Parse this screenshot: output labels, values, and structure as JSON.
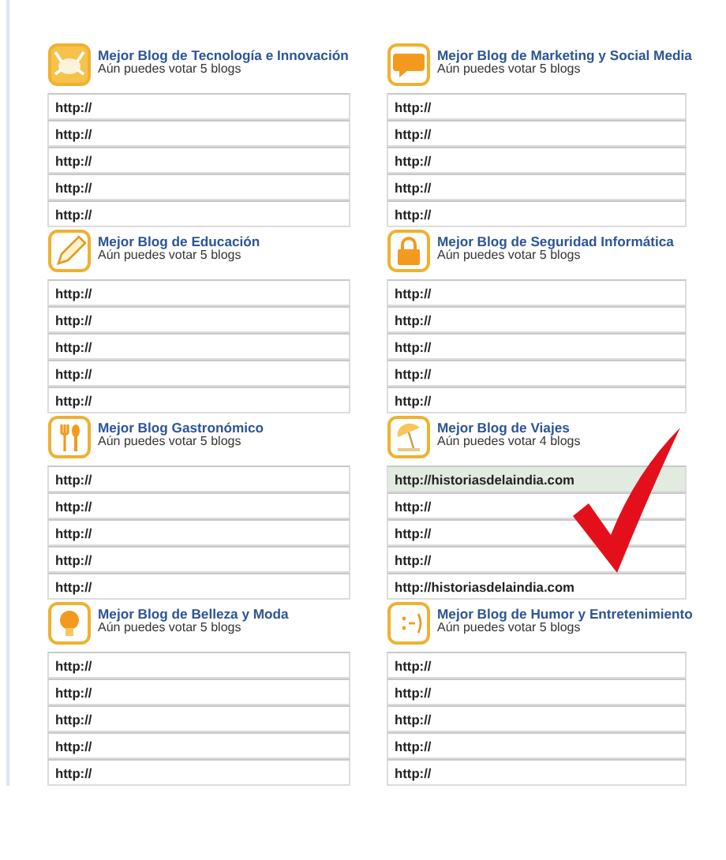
{
  "categories": [
    {
      "title": "Mejor Blog de Tecnología e Innovación",
      "subtitle": "Aún puedes votar 5 blogs",
      "marked": false,
      "fields": [
        {
          "value": "http://",
          "highlighted": false
        },
        {
          "value": "http://",
          "highlighted": false
        },
        {
          "value": "http://",
          "highlighted": false
        },
        {
          "value": "http://",
          "highlighted": false
        },
        {
          "value": "http://",
          "highlighted": false
        }
      ]
    },
    {
      "title": "Mejor Blog de Marketing y Social Media",
      "subtitle": "Aún puedes votar 5 blogs",
      "marked": false,
      "fields": [
        {
          "value": "http://",
          "highlighted": false
        },
        {
          "value": "http://",
          "highlighted": false
        },
        {
          "value": "http://",
          "highlighted": false
        },
        {
          "value": "http://",
          "highlighted": false
        },
        {
          "value": "http://",
          "highlighted": false
        }
      ]
    },
    {
      "title": "Mejor Blog de Educación",
      "subtitle": "Aún puedes votar 5 blogs",
      "marked": false,
      "fields": [
        {
          "value": "http://",
          "highlighted": false
        },
        {
          "value": "http://",
          "highlighted": false
        },
        {
          "value": "http://",
          "highlighted": false
        },
        {
          "value": "http://",
          "highlighted": false
        },
        {
          "value": "http://",
          "highlighted": false
        }
      ]
    },
    {
      "title": "Mejor Blog de Seguridad Informática",
      "subtitle": "Aún puedes votar 5 blogs",
      "marked": false,
      "fields": [
        {
          "value": "http://",
          "highlighted": false
        },
        {
          "value": "http://",
          "highlighted": false
        },
        {
          "value": "http://",
          "highlighted": false
        },
        {
          "value": "http://",
          "highlighted": false
        },
        {
          "value": "http://",
          "highlighted": false
        }
      ]
    },
    {
      "title": "Mejor Blog Gastronómico",
      "subtitle": "Aún puedes votar 5 blogs",
      "marked": false,
      "fields": [
        {
          "value": "http://",
          "highlighted": false
        },
        {
          "value": "http://",
          "highlighted": false
        },
        {
          "value": "http://",
          "highlighted": false
        },
        {
          "value": "http://",
          "highlighted": false
        },
        {
          "value": "http://",
          "highlighted": false
        }
      ]
    },
    {
      "title": "Mejor Blog de Viajes",
      "subtitle": "Aún puedes votar 4 blogs",
      "marked": true,
      "fields": [
        {
          "value": "http://historiasdelaindia.com",
          "highlighted": true
        },
        {
          "value": "http://",
          "highlighted": false
        },
        {
          "value": "http://",
          "highlighted": false
        },
        {
          "value": "http://",
          "highlighted": false
        },
        {
          "value": "http://historiasdelaindia.com",
          "highlighted": false
        }
      ]
    },
    {
      "title": "Mejor Blog de Belleza y Moda",
      "subtitle": "Aún puedes votar 5 blogs",
      "marked": false,
      "fields": [
        {
          "value": "http://",
          "highlighted": false
        },
        {
          "value": "http://",
          "highlighted": false
        },
        {
          "value": "http://",
          "highlighted": false
        },
        {
          "value": "http://",
          "highlighted": false
        },
        {
          "value": "http://",
          "highlighted": false
        }
      ]
    },
    {
      "title": "Mejor Blog de Humor y Entretenimiento",
      "subtitle": "Aún puedes votar 5 blogs",
      "marked": false,
      "fields": [
        {
          "value": "http://",
          "highlighted": false
        },
        {
          "value": "http://",
          "highlighted": false
        },
        {
          "value": "http://",
          "highlighted": false
        },
        {
          "value": "http://",
          "highlighted": false
        },
        {
          "value": "http://",
          "highlighted": false
        }
      ]
    }
  ]
}
